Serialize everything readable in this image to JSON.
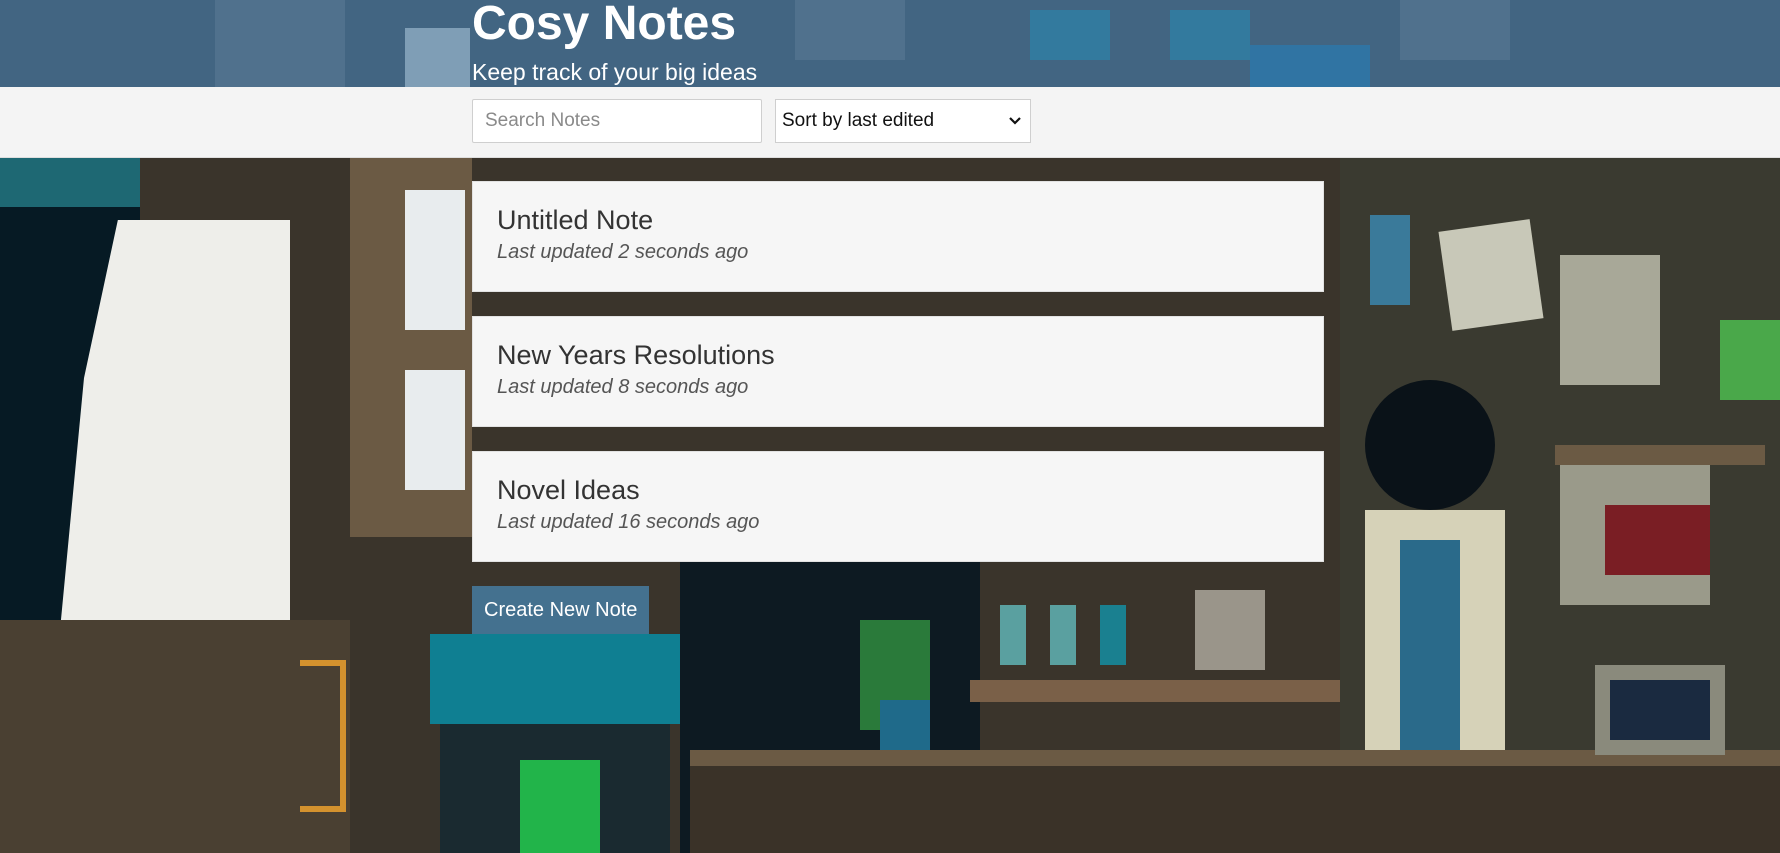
{
  "header": {
    "title": "Cosy Notes",
    "subtitle": "Keep track of your big ideas"
  },
  "actions": {
    "search_placeholder": "Search Notes",
    "search_value": "",
    "sort_selected": "Sort by last edited"
  },
  "notes": [
    {
      "title": "Untitled Note",
      "updated": "Last updated 2 seconds ago"
    },
    {
      "title": "New Years Resolutions",
      "updated": "Last updated 8 seconds ago"
    },
    {
      "title": "Novel Ideas",
      "updated": "Last updated 16 seconds ago"
    }
  ],
  "create_button_label": "Create New Note",
  "colors": {
    "header_bg": "#426582",
    "actions_bg": "#f4f4f4",
    "note_bg": "#f6f6f6",
    "button_bg": "#44718f"
  },
  "icons": {
    "sort_dropdown": "chevron-down-icon"
  }
}
